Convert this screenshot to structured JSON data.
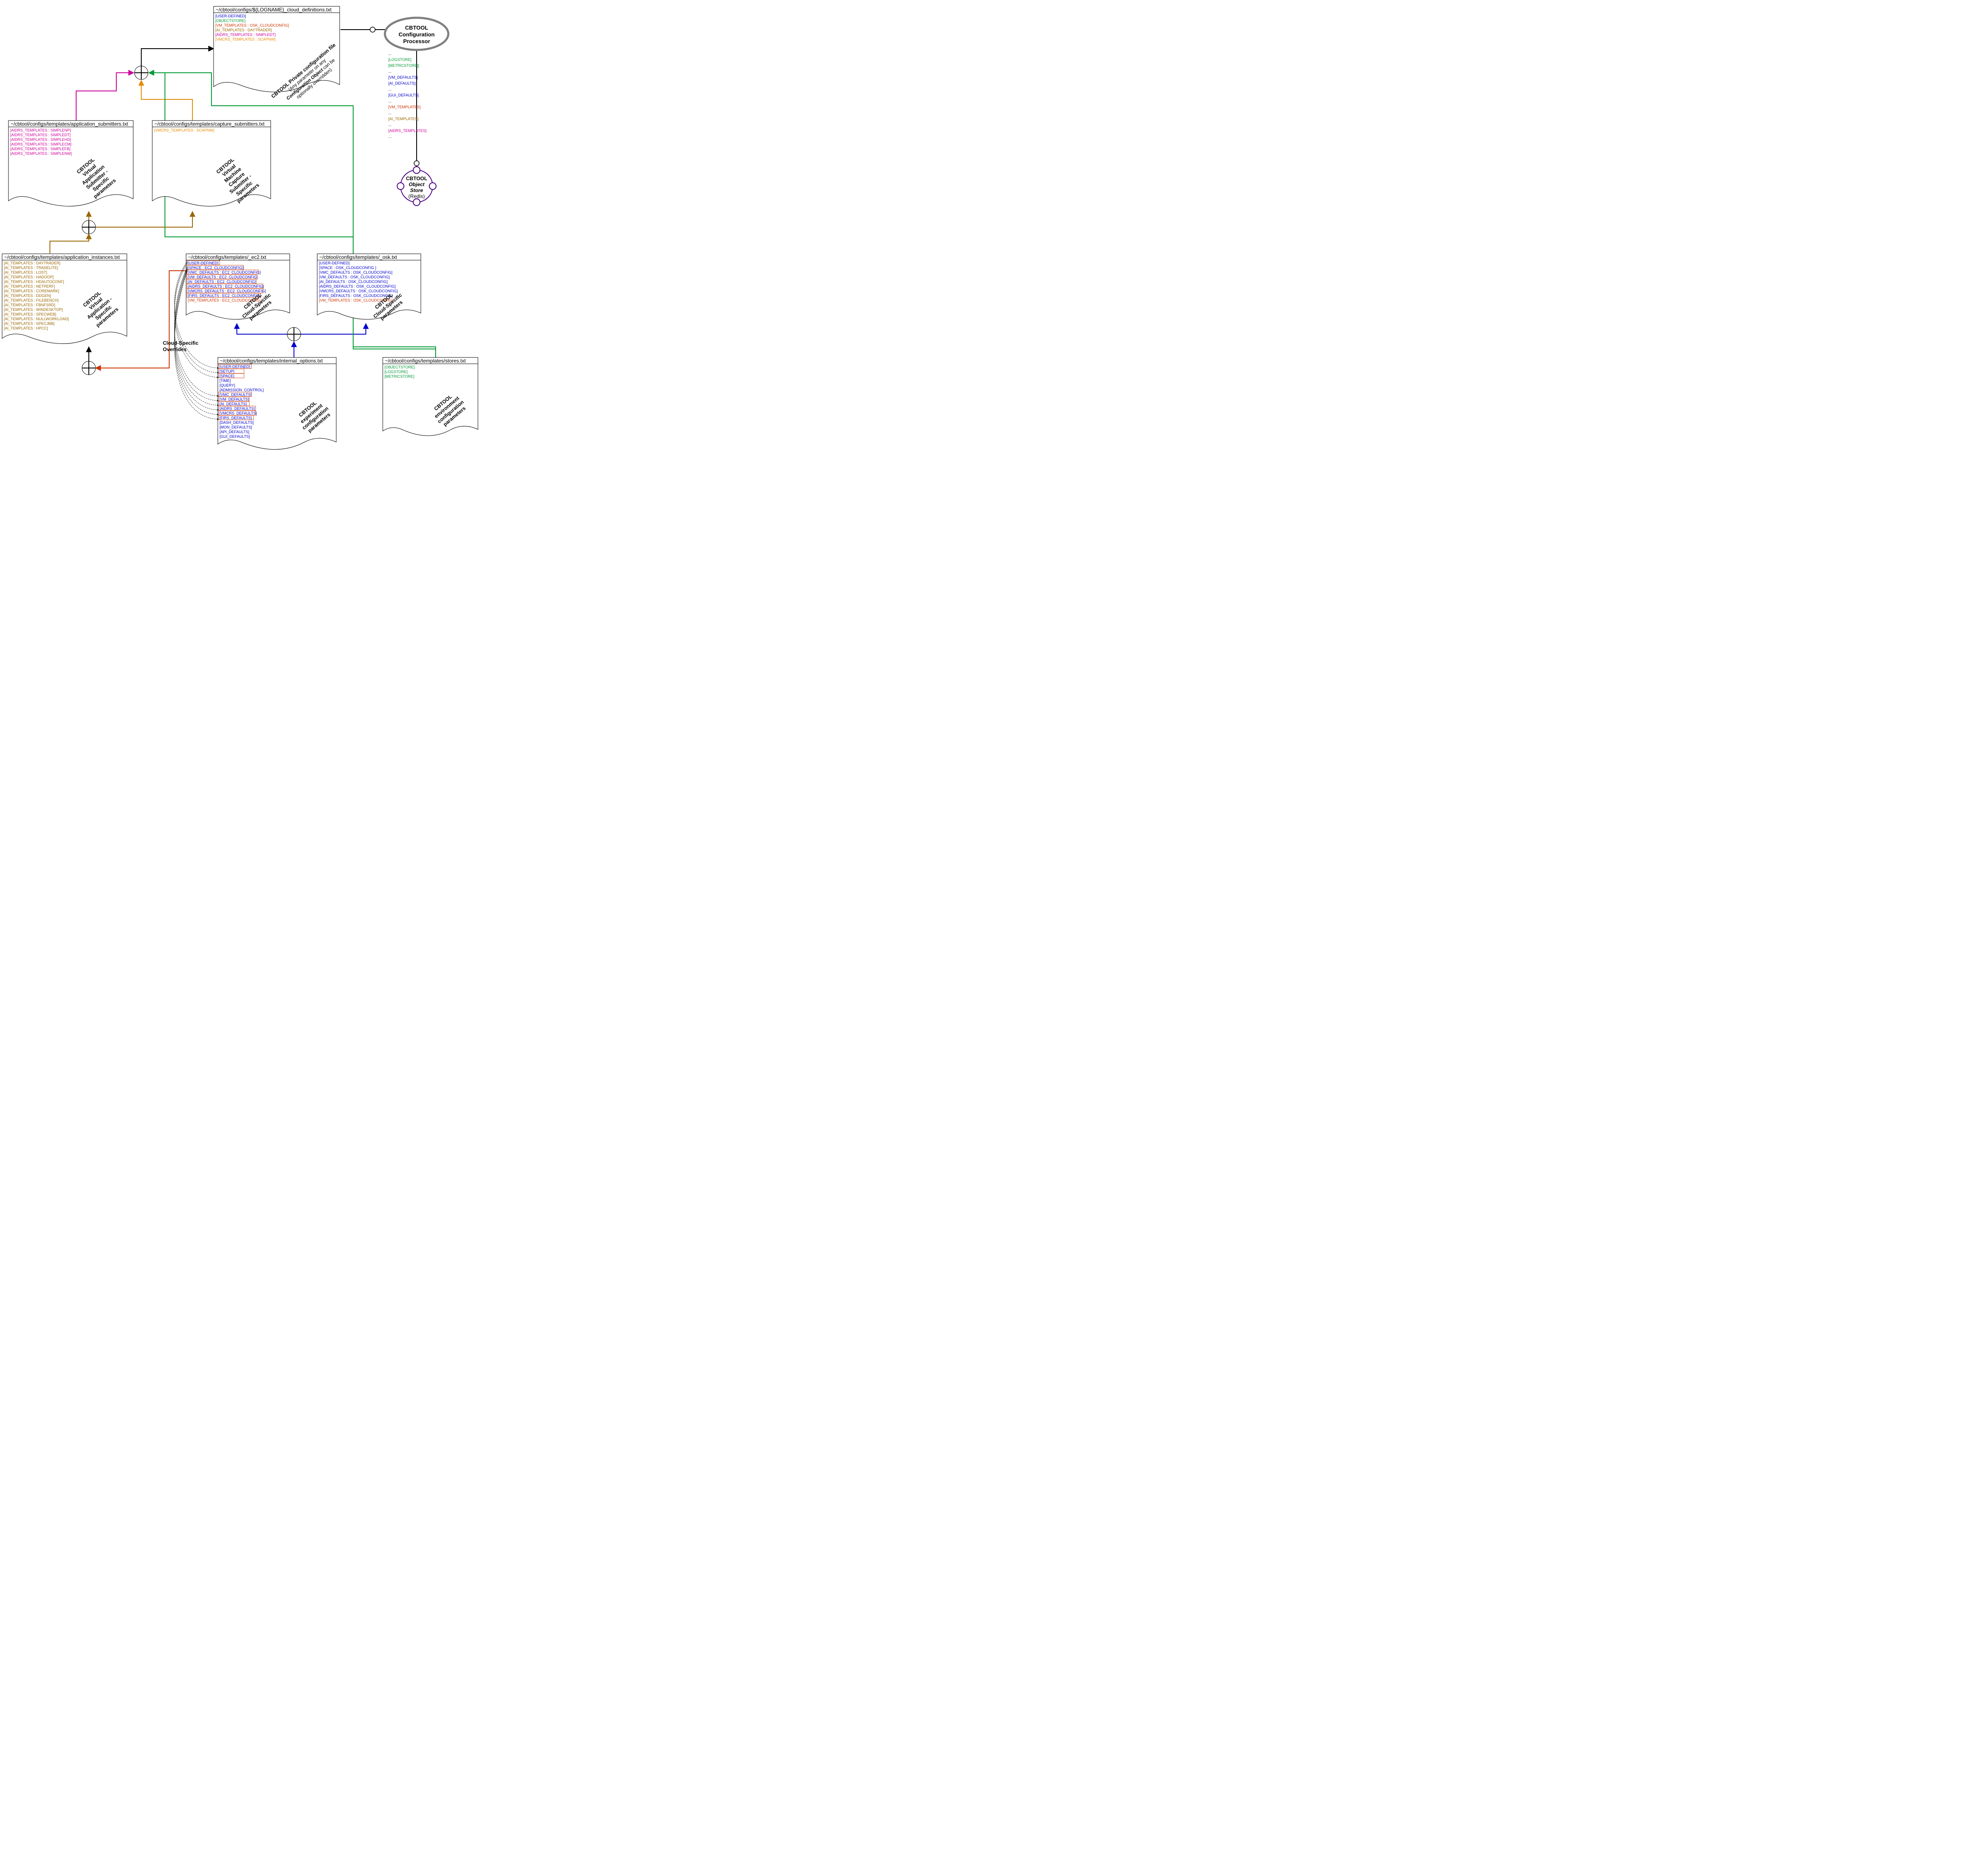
{
  "colors": {
    "blue": "#0000cc",
    "green": "#009933",
    "red": "#cc3300",
    "brown": "#996600",
    "magenta": "#cc0099",
    "orange": "#e68a00",
    "black": "#000000",
    "grey": "#808080",
    "purple": "#4b0082"
  },
  "overrides_label": "Cloud-Specific\nOverrides",
  "processor": {
    "l1": "CBTOOL",
    "l2": "Configuration",
    "l3": "Processor",
    "outputs": [
      {
        "text": "...",
        "color": "black"
      },
      {
        "text": "[LOGSTORE]",
        "color": "green"
      },
      {
        "text": "[METRICSTORE]]",
        "color": "green"
      },
      {
        "text": "...",
        "color": "black"
      },
      {
        "text": "[VM_DEFAULTS]",
        "color": "blue"
      },
      {
        "text": "[AI_DEFAULTS]",
        "color": "blue"
      },
      {
        "text": "...",
        "color": "black"
      },
      {
        "text": "[GUI_DEFAULTS]",
        "color": "blue"
      },
      {
        "text": "...",
        "color": "black"
      },
      {
        "text": "[VM_TEMPLATES]",
        "color": "red"
      },
      {
        "text": "...",
        "color": "black"
      },
      {
        "text": "[AI_TEMPLATES]",
        "color": "brown"
      },
      {
        "text": "...",
        "color": "black"
      },
      {
        "text": "[AIDRS_TEMPLATES]",
        "color": "magenta"
      },
      {
        "text": "...",
        "color": "black"
      }
    ]
  },
  "objectstore": {
    "l1": "CBTOOL",
    "l2": "Object",
    "l3": "Store",
    "l4": "(Redis)"
  },
  "files": {
    "private": {
      "path": "~/cbtool/configs/${LOGNAME}_cloud_definitions.txt",
      "headers": [
        {
          "text": "[USER-DEFINED]",
          "color": "blue"
        },
        {
          "text": "[OBJECTSTORE]",
          "color": "green"
        },
        {
          "text": "[VM_TEMPLATES : OSK_CLOUDCONFIG]",
          "color": "red"
        },
        {
          "text": "[AI_TEMPLATES : DAYTRADER]",
          "color": "brown"
        },
        {
          "text": "[AIDRS_TEMPLATES : SIMPLEDT]",
          "color": "magenta"
        },
        {
          "text": "[VMCRS_TEMPLATES : SCAPNW]",
          "color": "orange"
        }
      ],
      "desc": [
        "CBTOOL  Private configuration file",
        "(Any parameter on any",
        "Configuration Object can be",
        "optionally overridden)"
      ]
    },
    "appsub": {
      "path": "~/cbtool/configs/templates/application_submitters.txt",
      "headers": [
        {
          "text": "[AIDRS_TEMPLATES : SIMPLENP]",
          "color": "magenta"
        },
        {
          "text": "[AIDRS_TEMPLATES : SIMPLEDT]",
          "color": "magenta"
        },
        {
          "text": "[AIDRS_TEMPLATES : SIMPLEHD]",
          "color": "magenta"
        },
        {
          "text": "[AIDRS_TEMPLATES : SIMPLECM]",
          "color": "magenta"
        },
        {
          "text": "[AIDRS_TEMPLATES : SIMPLEFB]",
          "color": "magenta"
        },
        {
          "text": "[AIDRS_TEMPLATES : SIMPLENW]",
          "color": "magenta"
        }
      ],
      "desc": [
        "CBTOOL",
        "Virtual",
        "Application",
        "Submitter -",
        "Specific",
        "parameters"
      ]
    },
    "capsub": {
      "path": "~/cbtool/configs/templates/capture_submitters.txt",
      "headers": [
        {
          "text": "[VMCRS_TEMPLATES : SCAPNW]",
          "color": "orange"
        }
      ],
      "desc": [
        "CBTOOL",
        "Virtual",
        "Machine",
        "Capture",
        "Submitter -",
        "Specific",
        "parameters"
      ]
    },
    "appinst": {
      "path": "~/cbtool/configs/templates/application_instances.txt",
      "headers": [
        {
          "text": "[AI_TEMPLATES : DAYTRADER]",
          "color": "brown"
        },
        {
          "text": "[AI_TEMPLATES : TRADELITE]",
          "color": "brown"
        },
        {
          "text": "[AI_TEMPLATES : LOST]",
          "color": "brown"
        },
        {
          "text": "[AI_TEMPLATES : HADOOP]",
          "color": "brown"
        },
        {
          "text": "[AI_TEMPLATES : HDAUTOCONF]",
          "color": "brown"
        },
        {
          "text": "[AI_TEMPLATES : NETPERF]",
          "color": "brown"
        },
        {
          "text": "[AI_TEMPLATES : COREMARK]",
          "color": "brown"
        },
        {
          "text": "[AI_TEMPLATES : DDGEN]",
          "color": "brown"
        },
        {
          "text": "[AI_TEMPLATES : FILEBENCH]",
          "color": "brown"
        },
        {
          "text": "[AI_TEMPLATES : FBNFSRD]",
          "color": "brown"
        },
        {
          "text": "[AI_TEMPLATES : WINDESKTOP]",
          "color": "brown"
        },
        {
          "text": "[AI_TEMPLATES : SPECWEB]",
          "color": "brown"
        },
        {
          "text": "[AI_TEMPLATES : NULLWORKLOAD]",
          "color": "brown"
        },
        {
          "text": "[AI_TEMPLATES : SPECJBB]",
          "color": "brown"
        },
        {
          "text": "[AI_TEMPLATES : HPCC]",
          "color": "brown"
        }
      ],
      "desc": [
        "CBTOOL",
        "Virtual",
        "Application -",
        "Specific",
        "parameters"
      ]
    },
    "ec2": {
      "path": "~/cbtool/configs/templates/_ec2.txt",
      "headers": [
        {
          "text": "[USER-DEFINED]",
          "color": "blue",
          "override": true
        },
        {
          "text": "[SPACE : EC2_CLOUDCONFIG]",
          "color": "blue",
          "override": true
        },
        {
          "text": "[VMC_DEFAULTS : EC2_CLOUDCONFIG]",
          "color": "blue",
          "override": true
        },
        {
          "text": "[VM_DEFAULTS : EC2_CLOUDCONFIG]",
          "color": "blue",
          "override": true
        },
        {
          "text": "[AI_DEFAULTS : EC2_CLOUDCONFIG]",
          "color": "blue",
          "override": true
        },
        {
          "text": "[AIDRS_DEFAULTS : EC2_CLOUDCONFIG]",
          "color": "blue",
          "override": true
        },
        {
          "text": "[VMCRS_DEFAULTS : EC2_CLOUDCONFIG]",
          "color": "blue",
          "override": true
        },
        {
          "text": "[FIRS_DEFAULTS : EC2_CLOUDCONFIG]",
          "color": "blue",
          "override": true
        },
        {
          "text": "[VM_TEMPLATES : EC2_CLOUDCONFIG ]",
          "color": "red"
        }
      ],
      "desc": [
        "CBTOOL",
        "Cloud-Specific",
        "parameters"
      ]
    },
    "osk": {
      "path": "~/cbtool/configs/templates/_osk.txt",
      "headers": [
        {
          "text": "[USER-DEFINED]",
          "color": "blue"
        },
        {
          "text": "[SPACE : OSK_CLOUDCONFIG ]",
          "color": "blue"
        },
        {
          "text": "[VMC_DEFAULTS : OSK_CLOUDCONFIG]",
          "color": "blue"
        },
        {
          "text": "[VM_DEFAULTS : OSK_CLOUDCONFIG]",
          "color": "blue"
        },
        {
          "text": "[AI_DEFAULTS : OSK_CLOUDCONFIG]",
          "color": "blue"
        },
        {
          "text": "[AIDRS_DEFAULTS : OSK_CLOUDCONFIG]",
          "color": "blue"
        },
        {
          "text": "[VMCRS_DEFAULTS : OSK_CLOUDCONFIG]",
          "color": "blue"
        },
        {
          "text": "[FIRS_DEFAULTS : OSK_CLOUDCONFIG]",
          "color": "blue"
        },
        {
          "text": "[VM_TEMPLATES : OSK_CLOUDCONFIG]",
          "color": "red"
        }
      ],
      "desc": [
        "CBTOOL",
        "Cloud-Specific",
        "parameters"
      ]
    },
    "internal": {
      "path": "~/cbtool/configs/templates/internal_options.txt",
      "headers": [
        {
          "text": "[USER-DEFINED]",
          "color": "blue",
          "override": true
        },
        {
          "text": "[SETUP]",
          "color": "blue",
          "override": true
        },
        {
          "text": "[SPACE]",
          "color": "blue",
          "override": true
        },
        {
          "text": "[TIME]",
          "color": "blue"
        },
        {
          "text": "[QUERY]",
          "color": "blue"
        },
        {
          "text": "[ADMISSION_CONTROL]",
          "color": "blue"
        },
        {
          "text": "[VMC_DEFAULTS]",
          "color": "blue",
          "override": true
        },
        {
          "text": "[VM_DEFAULTS]",
          "color": "blue",
          "override": true
        },
        {
          "text": "[AI_DEFAULTS]",
          "color": "blue",
          "override": true
        },
        {
          "text": "[AIDRS_DEFAULTS]",
          "color": "blue",
          "override": true
        },
        {
          "text": "[VMCRS_DEFAULTS]",
          "color": "blue",
          "override": true
        },
        {
          "text": "[FIRS_DEFAULTS]",
          "color": "blue",
          "override": true
        },
        {
          "text": "[DASH_DEFAULTS]",
          "color": "blue"
        },
        {
          "text": "[MON_DEFAULTS]",
          "color": "blue"
        },
        {
          "text": "[API_DEFAULTS]",
          "color": "blue"
        },
        {
          "text": "[GUI_DEFAULTS]",
          "color": "blue"
        }
      ],
      "desc": [
        "CBTOOL",
        "experiment",
        "configuration",
        "parameters"
      ]
    },
    "stores": {
      "path": "~/cbtool/configs/templates/stores.txt",
      "headers": [
        {
          "text": "[OBJECTSTORE]",
          "color": "green"
        },
        {
          "text": "[LOGSTORE]",
          "color": "green"
        },
        {
          "text": "[METRICSTORE]",
          "color": "green"
        }
      ],
      "desc": [
        "CBTOOL",
        "environment",
        "configuration",
        "parameters"
      ]
    }
  }
}
